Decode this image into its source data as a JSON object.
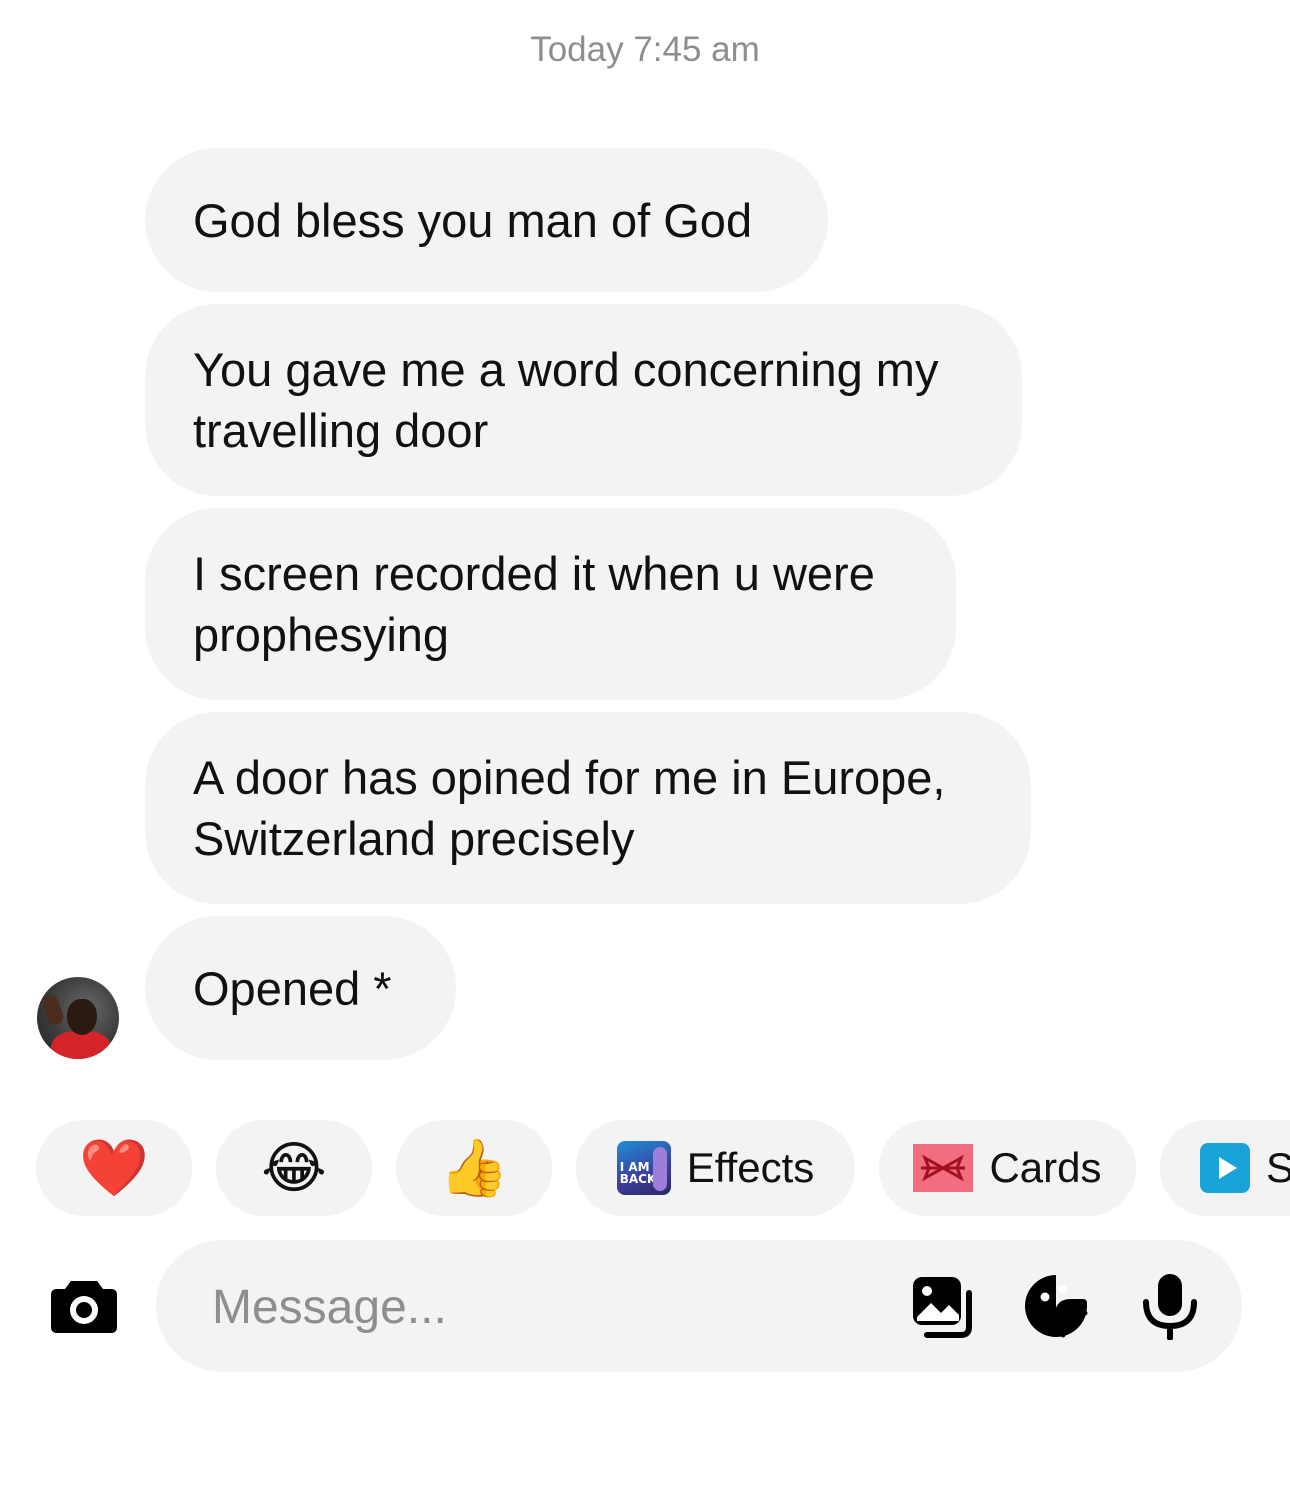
{
  "timestamp": "Today 7:45 am",
  "messages": [
    {
      "text": "God bless you man of God"
    },
    {
      "text": "You gave me a word concerning my\ntravelling door"
    },
    {
      "text": "I screen recorded it when u were\nprophesying"
    },
    {
      "text": "A door has opined for me in Europe,\nSwitzerland precisely"
    },
    {
      "text": "Opened *"
    }
  ],
  "quick_reactions": [
    {
      "emoji": "❤️",
      "icon": "heart-icon"
    },
    {
      "emoji": "😂",
      "icon": "tears-of-joy-icon"
    },
    {
      "emoji": "👍",
      "icon": "thumbs-up-icon"
    }
  ],
  "chips": {
    "effects": {
      "label": "Effects",
      "icon_text": "I AM\nBACK"
    },
    "cards": {
      "label": "Cards"
    },
    "third": {
      "label": "S"
    }
  },
  "composer": {
    "placeholder": "Message..."
  },
  "colors": {
    "bubble_bg": "#f3f3f3",
    "timestamp": "#8e8e8e",
    "text": "#111111"
  }
}
